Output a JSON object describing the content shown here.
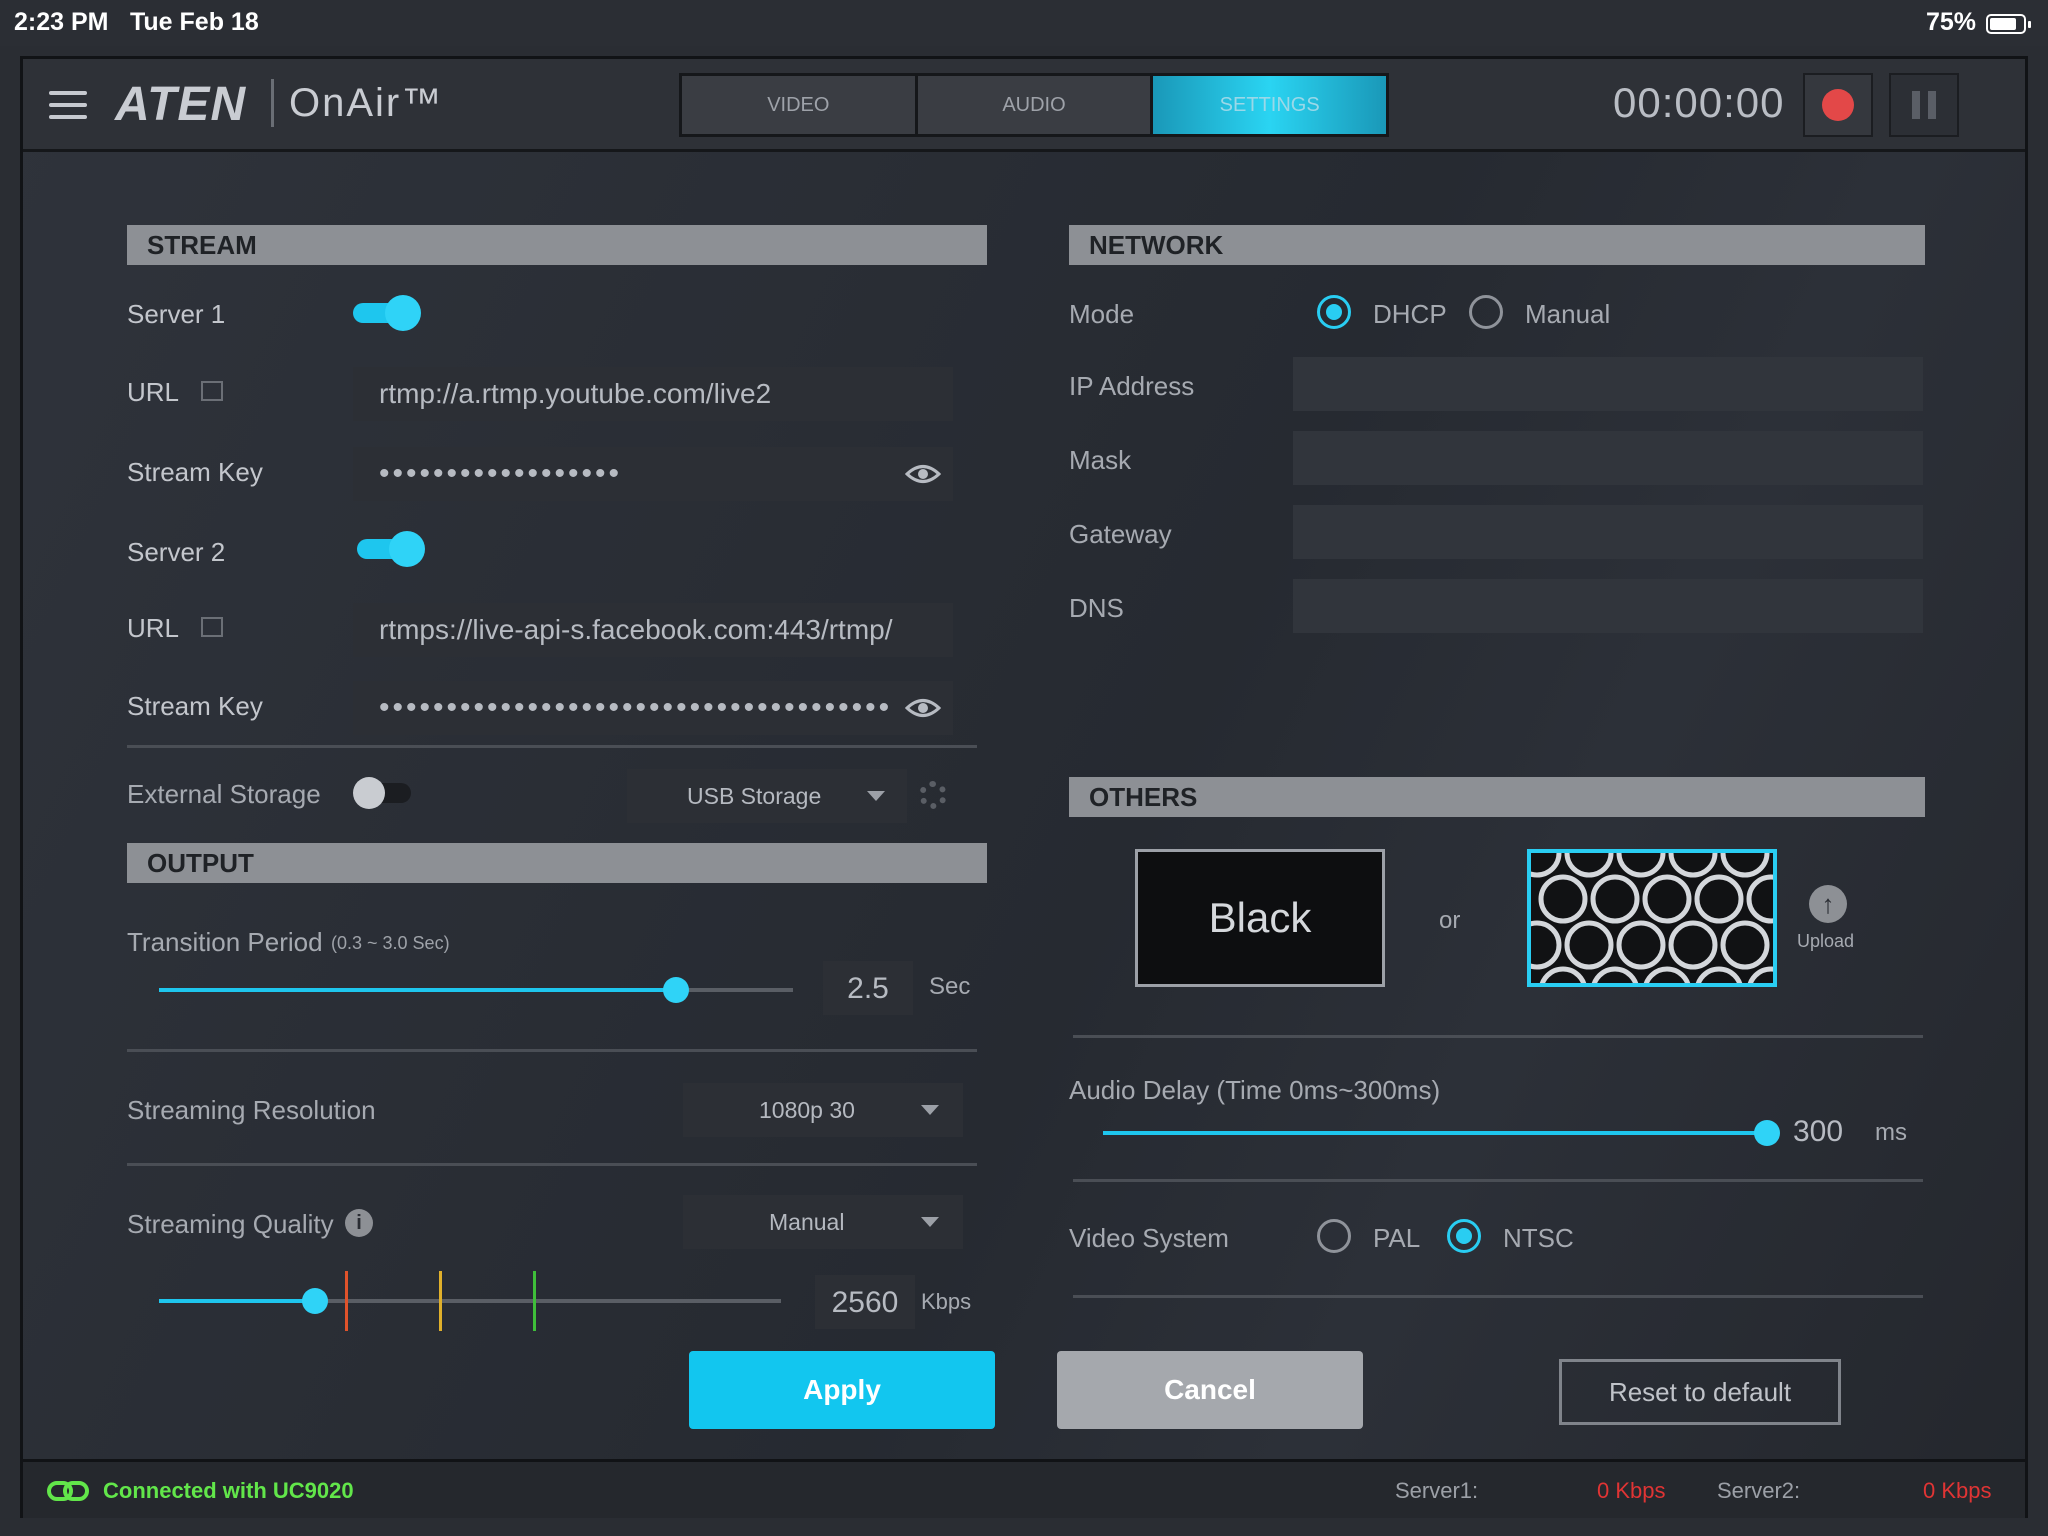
{
  "status_bar": {
    "time": "2:23 PM",
    "date": "Tue Feb 18",
    "battery": "75%",
    "battery_level": 0.75
  },
  "app": {
    "logo": "ATEN",
    "product": "OnAir™",
    "tabs": [
      {
        "label": "VIDEO",
        "active": false
      },
      {
        "label": "AUDIO",
        "active": false
      },
      {
        "label": "SETTINGS",
        "active": true
      }
    ],
    "timer": "00:00:00"
  },
  "stream": {
    "title": "STREAM",
    "server1": {
      "label": "Server 1",
      "enabled": true
    },
    "url1": {
      "label": "URL",
      "value": "rtmp://a.rtmp.youtube.com/live2"
    },
    "key1": {
      "label": "Stream Key",
      "value": "••••••••••••••••••"
    },
    "server2": {
      "label": "Server 2",
      "enabled": true
    },
    "url2": {
      "label": "URL",
      "value": "rtmps://live-api-s.facebook.com:443/rtmp/"
    },
    "key2": {
      "label": "Stream Key",
      "value": "••••••••••••••••••••••••••••••••••••••"
    },
    "external_storage": {
      "label": "External Storage",
      "enabled": false,
      "selected": "USB Storage"
    }
  },
  "output": {
    "title": "OUTPUT",
    "transition": {
      "label": "Transition Period",
      "range": "(0.3 ~ 3.0 Sec)",
      "value": "2.5",
      "unit": "Sec",
      "min": 0.3,
      "max": 3.0
    },
    "resolution": {
      "label": "Streaming Resolution",
      "selected": "1080p 30"
    },
    "quality": {
      "label": "Streaming Quality",
      "selected": "Manual",
      "value": "2560",
      "unit": "Kbps",
      "level": 0.25
    }
  },
  "network": {
    "title": "NETWORK",
    "mode": {
      "label": "Mode",
      "options": [
        "DHCP",
        "Manual"
      ],
      "selected": "DHCP"
    },
    "ip": {
      "label": "IP Address",
      "value": ""
    },
    "mask": {
      "label": "Mask",
      "value": ""
    },
    "gateway": {
      "label": "Gateway",
      "value": ""
    },
    "dns": {
      "label": "DNS",
      "value": ""
    }
  },
  "others": {
    "title": "OTHERS",
    "black_label": "Black",
    "or_label": "or",
    "upload_label": "Upload",
    "audio_delay": {
      "label": "Audio Delay (Time 0ms~300ms)",
      "value": "300",
      "unit": "ms",
      "level": 1.0
    },
    "video_system": {
      "label": "Video System",
      "options": [
        "PAL",
        "NTSC"
      ],
      "selected": "NTSC"
    }
  },
  "actions": {
    "apply": "Apply",
    "cancel": "Cancel",
    "reset": "Reset to default"
  },
  "footer": {
    "connection": "Connected with UC9020",
    "server1_label": "Server1:",
    "server1_rate": "0 Kbps",
    "server2_label": "Server2:",
    "server2_rate": "0 Kbps"
  },
  "colors": {
    "accent": "#1ec6ee",
    "record": "#e34848",
    "connected": "#62e64a",
    "rate_alert": "#e03434"
  }
}
